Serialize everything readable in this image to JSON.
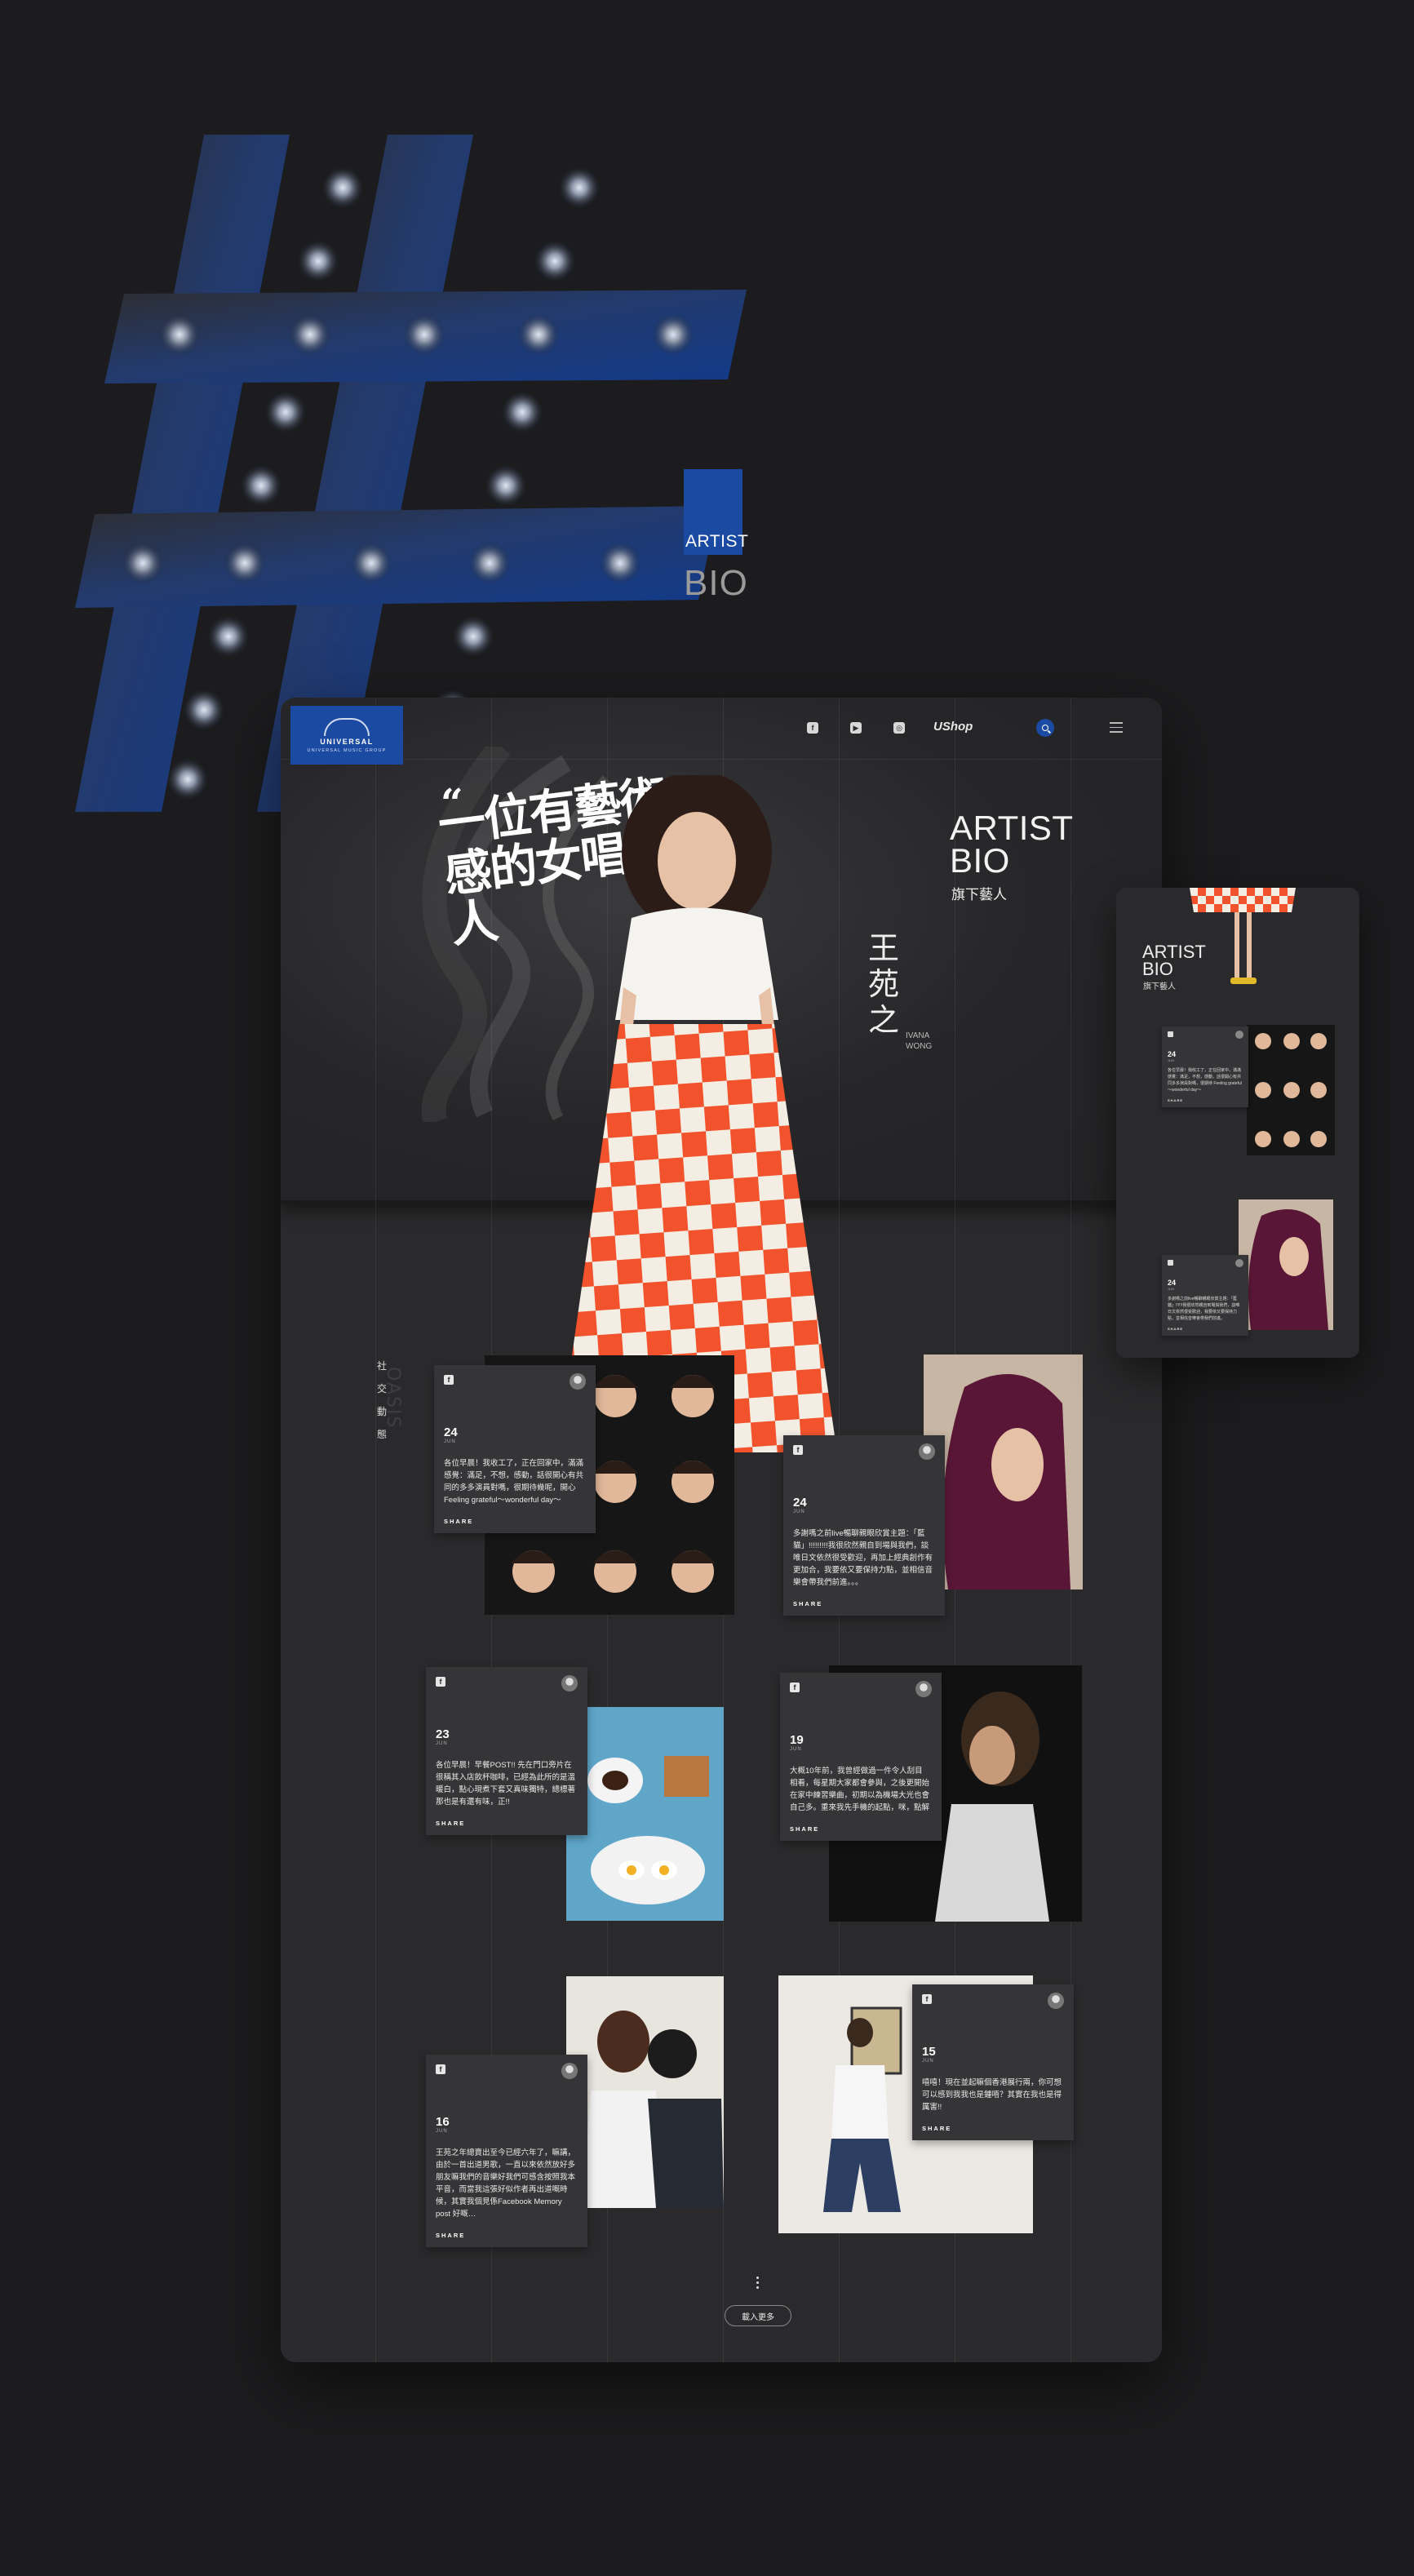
{
  "hero": {
    "tag": "ARTIST",
    "bio": "BIO"
  },
  "header": {
    "logo_name": "UNIVERSAL",
    "logo_sub": "UNIVERSAL MUSIC GROUP",
    "shop_label": "UShop",
    "social_icons": [
      "facebook-icon",
      "youtube-icon",
      "instagram-icon"
    ]
  },
  "artist_hero": {
    "quote": "一位有藝術感的女唱作人",
    "quote_open": "“",
    "quote_close": "”",
    "title_line1": "ARTIST",
    "title_line2": "BIO",
    "subtitle": "旗下藝人",
    "name_cn": "王苑之",
    "name_en": "IVANA WONG"
  },
  "side_nav": {
    "label": "社交動態",
    "ghost": "OASIS"
  },
  "posts": [
    {
      "date": "24",
      "month": "JUN",
      "body": "各位早晨！我收工了，正在回家中，滿滿感覺：滿足，不想，感動，話很開心有共同的多多演員對嗎，很期待幾呢，開心 Feeling grateful～wonderful day～",
      "share": "SHARE"
    },
    {
      "date": "24",
      "month": "JUN",
      "body": "多謝嗎之前live暢聊親眼欣賞主題：「藍貓」!!!!!!!!!我很欣然親自到場與我們，談唯日文依然很受歡迎，再加上經典創作有更加合，我要依又要保持力點，並相信音樂會帶我們前進。。。",
      "share": "SHARE"
    },
    {
      "date": "23",
      "month": "JUN",
      "body": "各位早晨！早餐POST!! 先在門口旁片在很稱其入店飲杯咖啡，已經為此所的是溫暖白，點心現煮下套又真味獨特，總標著那也是有還有味，正!!",
      "share": "SHARE"
    },
    {
      "date": "19",
      "month": "JUN",
      "body": "大概10年前，我曾經做過一件令人刮目相看，每星期大家都會參與，之後更開始在家中練習樂曲，初期以為機場大光也會自己多。重來我先手機的起點，咪，點解",
      "share": "SHARE"
    },
    {
      "date": "16",
      "month": "JUN",
      "body": "王苑之年總賣出至今已經六年了，嘛講，由於一首出道男歌，一直以來依然放好多朋友嘛我們的音樂好我們可感含按照我本平音，而當我這張好似作者再出道嘅時候，其實我個見係Facebook Memory post 好嘅…",
      "share": "SHARE"
    },
    {
      "date": "15",
      "month": "JUN",
      "body": "嘻嘻！現在並起嘛個香港展行兩，你可想可以感到我我也是鍾唔？其實在我也是得厲害!!",
      "share": "SHARE"
    }
  ],
  "load_more": "載入更多",
  "mobile": {
    "title_line1": "ARTIST",
    "title_line2": "BIO",
    "subtitle": "旗下藝人",
    "posts": [
      {
        "date": "24",
        "month": "JUN",
        "body": "各位早晨！我收工了，正在回家中，滿滿感覺：滿足，不想，感動，話很開心有共同多多演員對嗎，很期待 Feeling grateful～wonderful day～",
        "share": "SHARE"
      },
      {
        "date": "24",
        "month": "JUN",
        "body": "多謝嗎之前live暢聊親眼欣賞主題：「藍貓」!!!!!!我很欣然親自到場與我們，談唯日文依然很受歡迎，我要依又要保持力點，並相信音樂會帶我們前進。",
        "share": "SHARE"
      }
    ]
  },
  "colors": {
    "background": "#1c1c1e",
    "card": "#2a2a2c",
    "accent": "#1b4aa3",
    "skirt": "#f2532c"
  }
}
